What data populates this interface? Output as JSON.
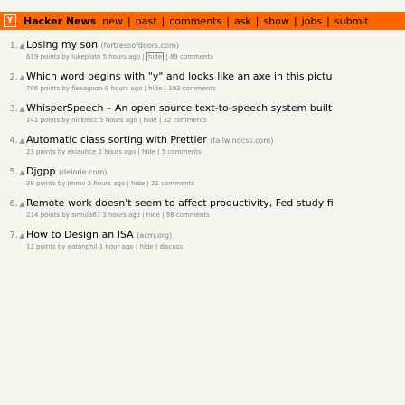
{
  "header": {
    "logo_letter": "Y",
    "site_name": "Hacker News",
    "nav": [
      "new",
      "past",
      "comments",
      "ask",
      "show",
      "jobs",
      "submit"
    ],
    "nav_separator": "|"
  },
  "vote_glyph": "▲",
  "meta_separator": "|",
  "stories": [
    {
      "rank": "1.",
      "title": "Losing my son",
      "site": "(fortressofdoors.com)",
      "points": "619 points by lukeplato",
      "age": "5 hours ago",
      "hide": "hide",
      "comments": "89 comments"
    },
    {
      "rank": "2.",
      "title": "Which word begins with \"y\" and looks like an axe in this pictu",
      "site": "",
      "points": "786 points by flexagoon",
      "age": "9 hours ago",
      "hide": "hide",
      "comments": "192 comments"
    },
    {
      "rank": "3.",
      "title": "WhisperSpeech – An open source text-to-speech system built",
      "site": "",
      "points": "141 points by nickmcc",
      "age": "5 hours ago",
      "hide": "hide",
      "comments": "32 comments"
    },
    {
      "rank": "4.",
      "title": "Automatic class sorting with Prettier",
      "site": "(tailwindcss.com)",
      "points": "23 points by ekiauhce",
      "age": "2 hours ago",
      "hide": "hide",
      "comments": "5 comments"
    },
    {
      "rank": "5.",
      "title": "Djgpp",
      "site": "(delorie.com)",
      "points": "38 points by jmmv",
      "age": "2 hours ago",
      "hide": "hide",
      "comments": "21 comments"
    },
    {
      "rank": "6.",
      "title": "Remote work doesn't seem to affect productivity, Fed study fi",
      "site": "",
      "points": "214 points by simula67",
      "age": "3 hours ago",
      "hide": "hide",
      "comments": "98 comments"
    },
    {
      "rank": "7.",
      "title": "How to Design an ISA",
      "site": "(acm.org)",
      "points": "12 points by eatonphil",
      "age": "1 hour ago",
      "hide": "hide",
      "comments": "discuss"
    }
  ]
}
